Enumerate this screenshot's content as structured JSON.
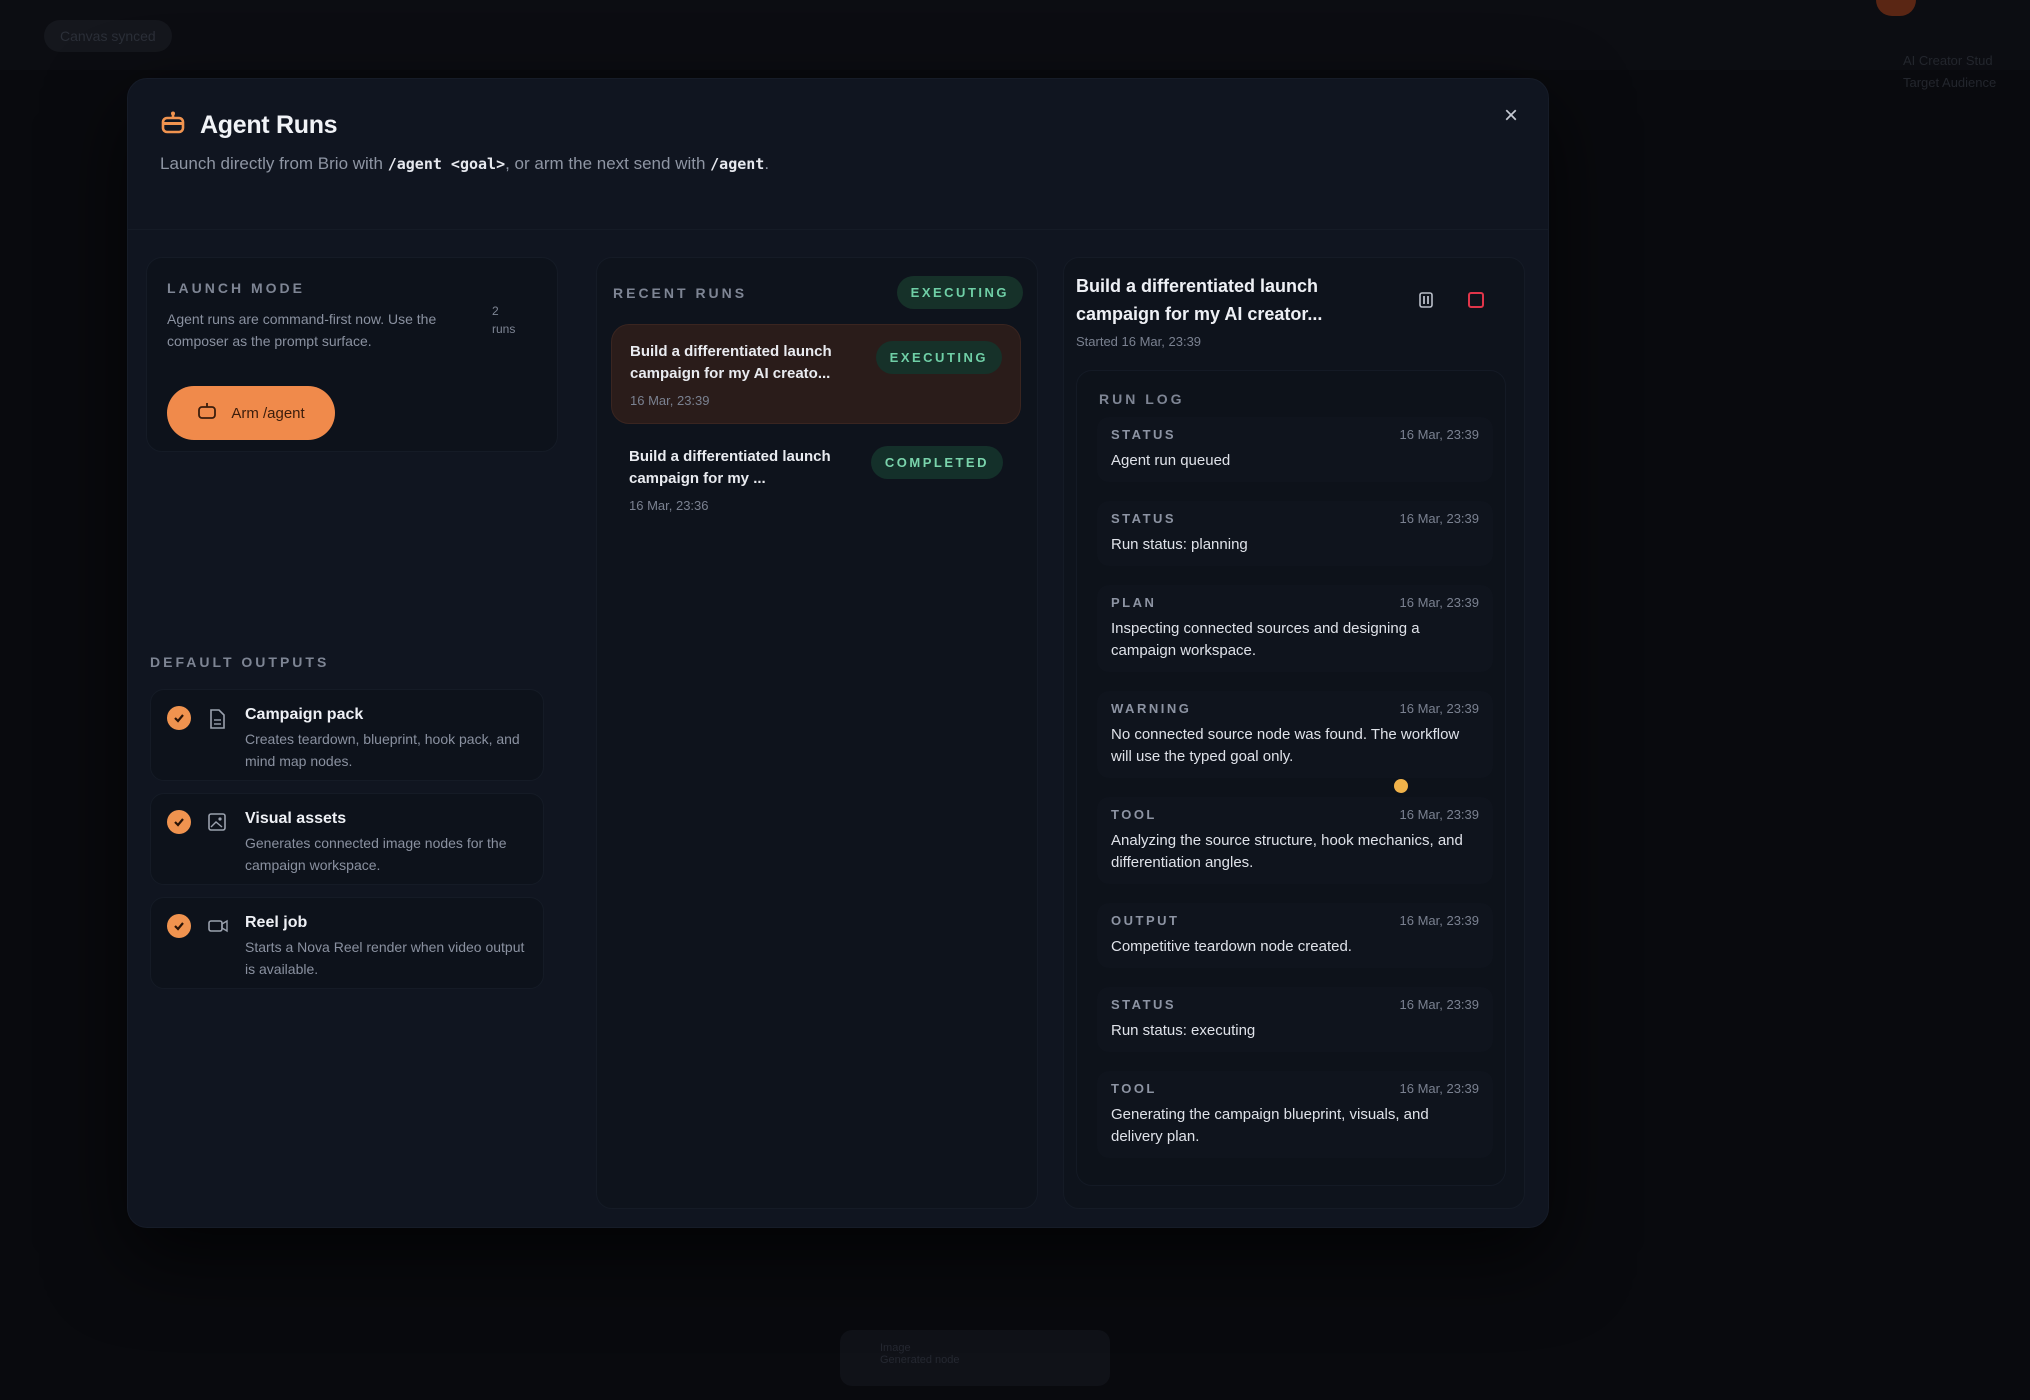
{
  "background": {
    "chips": [
      "Canvas synced"
    ],
    "right_panel": [
      "AI Creator Stud",
      "Target Audience"
    ],
    "toast": {
      "title": "Image",
      "text": "Generated node"
    }
  },
  "modal": {
    "title": "Agent Runs",
    "subtitle_prefix": "Launch directly from Brio with ",
    "subtitle_code1": "/agent <goal>",
    "subtitle_mid": ", or arm the next send with ",
    "subtitle_code2": "/agent",
    "subtitle_suffix": ".",
    "close_label": "×"
  },
  "launch_mode": {
    "label": "LAUNCH MODE",
    "description": "Agent runs are command-first now. Use the composer as the prompt surface.",
    "runs_count": "2",
    "runs_unit": "runs",
    "arm_button": "Arm /agent"
  },
  "default_outputs": {
    "label": "DEFAULT OUTPUTS",
    "items": [
      {
        "title": "Campaign pack",
        "desc": "Creates teardown, blueprint, hook pack, and mind map nodes.",
        "icon": "document-icon"
      },
      {
        "title": "Visual assets",
        "desc": "Generates connected image nodes for the campaign workspace.",
        "icon": "image-icon"
      },
      {
        "title": "Reel job",
        "desc": "Starts a Nova Reel render when video output is available.",
        "icon": "video-icon"
      }
    ]
  },
  "recent_runs": {
    "label": "RECENT RUNS",
    "header_badge": "EXECUTING",
    "runs": [
      {
        "title": "Build a differentiated launch campaign for my AI creato...",
        "time": "16 Mar, 23:39",
        "status": "EXECUTING"
      },
      {
        "title": "Build a differentiated launch campaign for my ...",
        "time": "16 Mar, 23:36",
        "status": "COMPLETED"
      }
    ]
  },
  "run_detail": {
    "title": "Build a differentiated launch campaign for my AI creator...",
    "started": "Started 16 Mar, 23:39",
    "log_label": "RUN LOG",
    "entries": [
      {
        "type": "STATUS",
        "time": "16 Mar, 23:39",
        "text": "Agent run queued"
      },
      {
        "type": "STATUS",
        "time": "16 Mar, 23:39",
        "text": "Run status: planning"
      },
      {
        "type": "PLAN",
        "time": "16 Mar, 23:39",
        "text": "Inspecting connected sources and designing a campaign workspace."
      },
      {
        "type": "WARNING",
        "time": "16 Mar, 23:39",
        "text": "No connected source node was found. The workflow will use the typed goal only."
      },
      {
        "type": "TOOL",
        "time": "16 Mar, 23:39",
        "text": "Analyzing the source structure, hook mechanics, and differentiation angles."
      },
      {
        "type": "OUTPUT",
        "time": "16 Mar, 23:39",
        "text": "Competitive teardown node created."
      },
      {
        "type": "STATUS",
        "time": "16 Mar, 23:39",
        "text": "Run status: executing"
      },
      {
        "type": "TOOL",
        "time": "16 Mar, 23:39",
        "text": "Generating the campaign blueprint, visuals, and delivery plan."
      }
    ]
  },
  "colors": {
    "accent": "#f08a4b",
    "success": "#6fcfa6",
    "warning": "#f0b24a",
    "danger": "#e0354a"
  }
}
